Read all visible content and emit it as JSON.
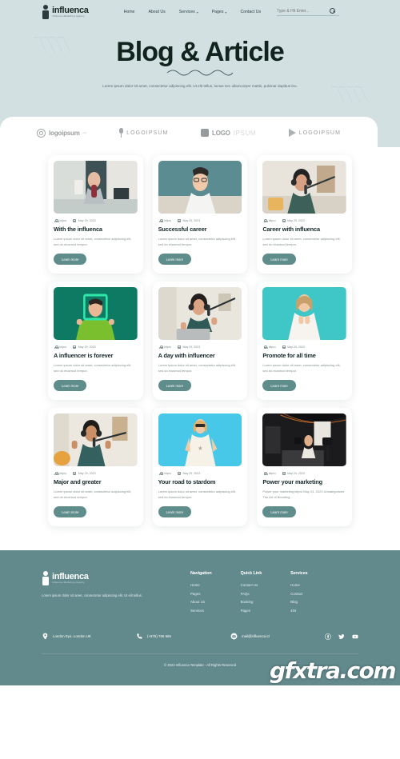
{
  "brand": {
    "name": "influenca",
    "tagline": "influence Marketing Agency"
  },
  "nav": {
    "items": [
      {
        "label": "Home",
        "has_dropdown": false
      },
      {
        "label": "About Us",
        "has_dropdown": false
      },
      {
        "label": "Services",
        "has_dropdown": true
      },
      {
        "label": "Pages",
        "has_dropdown": true
      },
      {
        "label": "Contact Us",
        "has_dropdown": false
      }
    ],
    "search_placeholder": "Type & Hit Enter...",
    "search_value": ""
  },
  "hero": {
    "title": "Blog & Article",
    "subtitle": "Lorem ipsum dolor sit amet, consectetur adipiscing elit. Ut elit tellus, luctus nec ullamcorper mattis, pulvinar dapibus leo."
  },
  "logo_strip": [
    {
      "name": "logoipsum",
      "sub": "com",
      "icon": "spiral-circle-icon"
    },
    {
      "name": "LOGOIPSUM",
      "sub": "",
      "icon": "microphone-icon"
    },
    {
      "name": "LOGO",
      "sub": "IPSUM",
      "icon": "square-block-icon"
    },
    {
      "name": "LOGOIPSUM",
      "sub": "",
      "icon": "play-triangle-icon"
    }
  ],
  "cards": [
    {
      "author": "kitpro",
      "date": "May 29, 2023",
      "title": "With the influenca",
      "excerpt": "Lorem ipsum dolor sit amet, consectetur adipiscing elit, sed do eiusmod tempor.",
      "button": "Learn more",
      "image": "woman-podcasting-at-home-desk"
    },
    {
      "author": "kitpro",
      "date": "May 29, 2023",
      "title": "Successful career",
      "excerpt": "Lorem ipsum dolor sit amet, consectetur adipiscing elit, sed do eiusmod tempor.",
      "button": "Learn more",
      "image": "man-with-glasses-on-teal-background"
    },
    {
      "author": "kitpro",
      "date": "May 29, 2023",
      "title": "Career with influenca",
      "excerpt": "Lorem ipsum dolor sit amet, consectetur adipiscing elit, sed do eiusmod tempor.",
      "button": "Learn more",
      "image": "woman-with-headphones-and-mic"
    },
    {
      "author": "kitpro",
      "date": "May 29, 2023",
      "title": "A influencer is forever",
      "excerpt": "Lorem ipsum dolor sit amet, consectetur adipiscing elit, sed do eiusmod tempor.",
      "button": "Learn more",
      "image": "man-holding-green-frame"
    },
    {
      "author": "kitpro",
      "date": "May 29, 2023",
      "title": "A day with influencer",
      "excerpt": "Lorem ipsum dolor sit amet, consectetur adipiscing elit, sed do eiusmod tempor.",
      "button": "Learn more",
      "image": "woman-streaming-with-laptop"
    },
    {
      "author": "kitpro",
      "date": "May 29, 2023",
      "title": "Promote for all time",
      "excerpt": "Lorem ipsum dolor sit amet, consectetur adipiscing elit, sed do eiusmod tempor.",
      "button": "Learn more",
      "image": "woman-on-turquoise-background"
    },
    {
      "author": "kitpro",
      "date": "May 29, 2023",
      "title": "Major and greater",
      "excerpt": "Lorem ipsum dolor sit amet, consectetur adipiscing elit, sed do eiusmod tempor.",
      "button": "Learn more",
      "image": "woman-headphones-hands-up"
    },
    {
      "author": "kitpro",
      "date": "May 29, 2023",
      "title": "Your road to stardom",
      "excerpt": "Lorem ipsum dolor sit amet, consectetur adipiscing elit, sed do eiusmod tempor.",
      "button": "Learn more",
      "image": "woman-in-white-dress-blue-background"
    },
    {
      "author": "kitpro",
      "date": "May 24, 2023",
      "title": "Power your marketing",
      "excerpt": "Power your marketing kitpro May 24, 2023 Uncategorized The Art of Blonding...",
      "button": "Learn more",
      "image": "studio-filming-setup"
    }
  ],
  "footer": {
    "about": "Lorem ipsum dolor sit amet, consectetur adipiscing elit. Ut elit tellus.",
    "columns": [
      {
        "title": "Navigation",
        "links": [
          "Home",
          "Pages",
          "About Us",
          "Services"
        ]
      },
      {
        "title": "Quick Link",
        "links": [
          "Contact Us",
          "FAQs",
          "Booking",
          "Pages"
        ]
      },
      {
        "title": "Services",
        "links": [
          "Home",
          "Contact",
          "Blog",
          "404"
        ]
      }
    ],
    "contacts": [
      {
        "icon": "location-pin-icon",
        "text": "London Eye, London UK"
      },
      {
        "icon": "phone-icon",
        "text": "(+876) 765 665"
      },
      {
        "icon": "mail-icon",
        "text": "mail@influenca.id"
      }
    ],
    "socials": [
      "facebook-icon",
      "twitter-icon",
      "youtube-icon"
    ],
    "copyright": "© 2023 Influenca Template - All Rights Reserved"
  },
  "watermark": "gfxtra.com",
  "colors": {
    "hero_bg": "#d3e0e2",
    "footer_bg": "#628a8d",
    "accent": "#5e8d8c",
    "heading": "#10241d"
  }
}
